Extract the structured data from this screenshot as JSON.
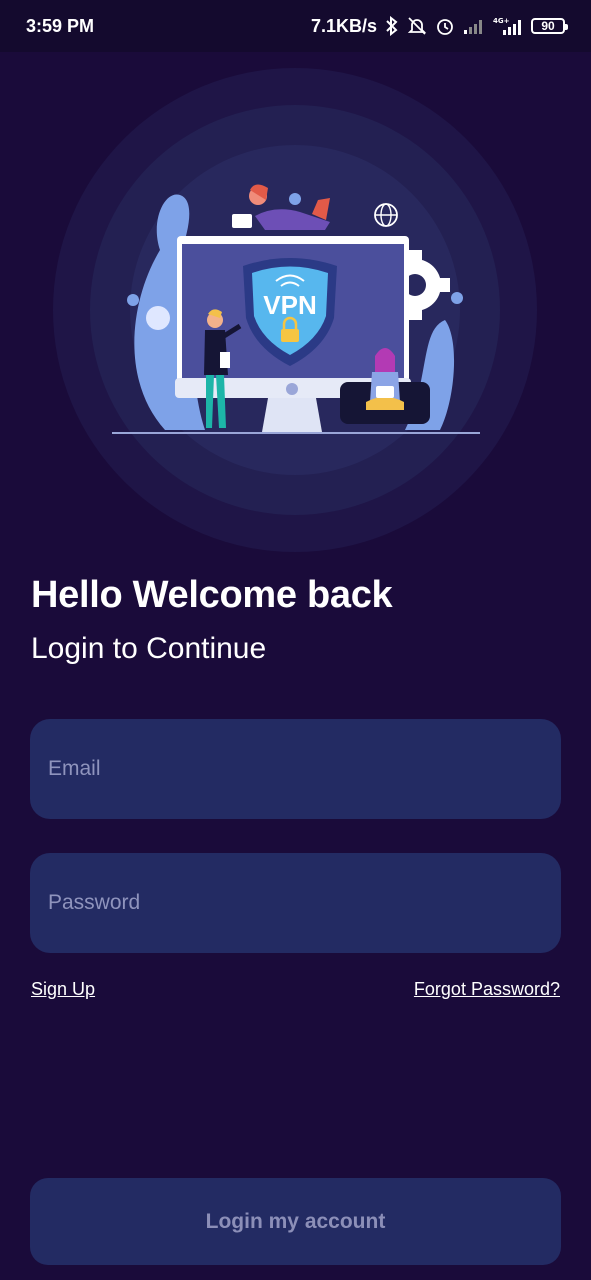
{
  "status_bar": {
    "time": "3:59 PM",
    "network_speed": "7.1KB/s",
    "battery": "90",
    "network_type": "4G+",
    "icons": [
      "bluetooth-icon",
      "bell-muted-icon",
      "alarm-icon",
      "signal-icon",
      "signal-4g-icon",
      "battery-icon"
    ]
  },
  "hero": {
    "screen_text": "VPN",
    "illustration": "vpn-monitor-illustration"
  },
  "welcome": {
    "title": "Hello Welcome back",
    "subtitle": "Login to Continue"
  },
  "form": {
    "email_placeholder": "Email",
    "password_placeholder": "Password",
    "sign_up_label": "Sign Up",
    "forgot_label": "Forgot Password?",
    "login_label": "Login my account"
  },
  "colors": {
    "background": "#1a0b3a",
    "field": "#232b63",
    "placeholder": "#8f94bd",
    "accent": "#7aa2e6"
  }
}
